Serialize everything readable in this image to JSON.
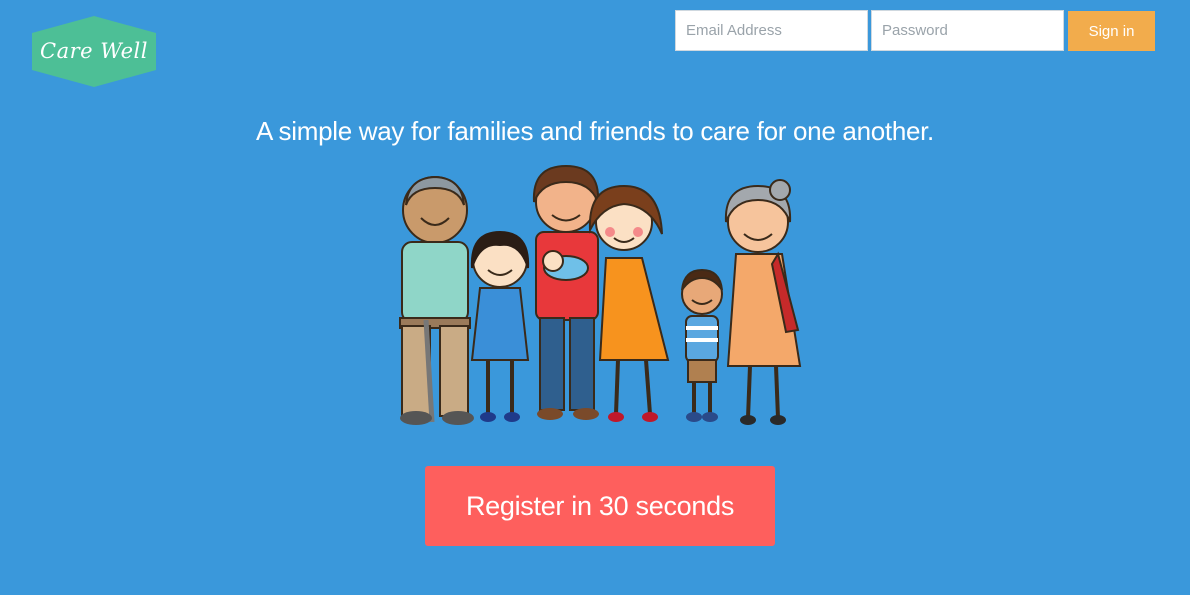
{
  "colors": {
    "background": "#3a98db",
    "logo_badge": "#4dbf96",
    "sign_in_button": "#f2ac4c",
    "register_button": "#fe5f5d",
    "text_light": "#ffffff"
  },
  "header": {
    "logo_text": "Care Well",
    "login": {
      "email_placeholder": "Email Address",
      "email_value": "",
      "password_placeholder": "Password",
      "password_value": "",
      "sign_in_label": "Sign in"
    }
  },
  "hero": {
    "tagline": "A simple way for families and friends to care for one another.",
    "illustration_icon": "family-illustration-icon",
    "register_label": "Register in 30 seconds"
  }
}
